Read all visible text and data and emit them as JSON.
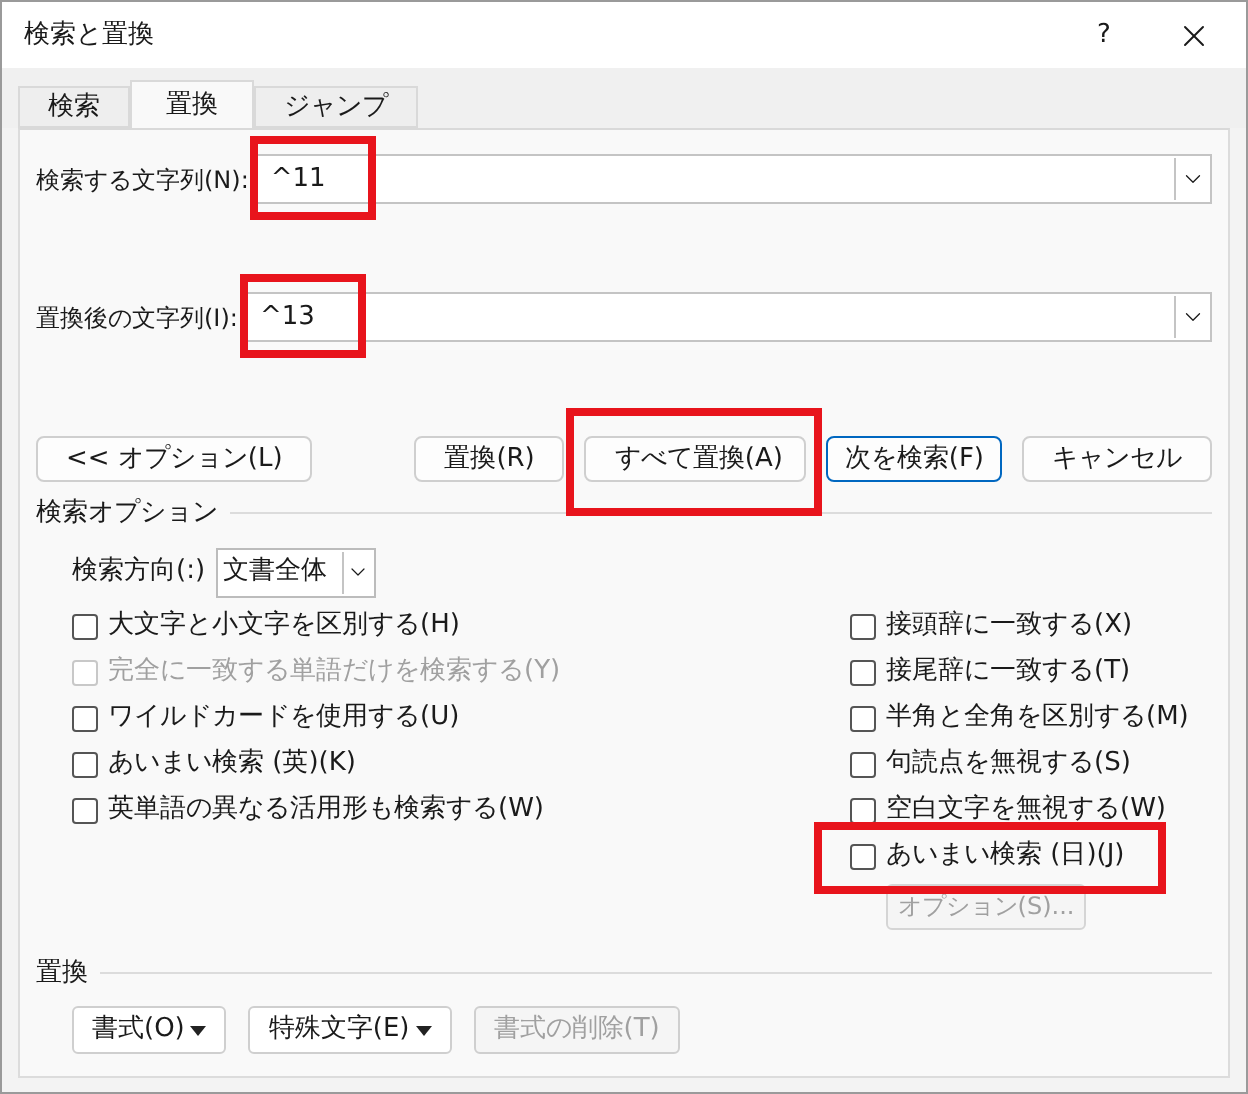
{
  "window": {
    "title": "検索と置換",
    "help": "?"
  },
  "tabs": [
    {
      "label": "検索",
      "selected": false
    },
    {
      "label": "置換",
      "selected": true
    },
    {
      "label": "ジャンプ",
      "selected": false
    }
  ],
  "fields": [
    {
      "label": "検索する文字列(N):",
      "value": "^11",
      "highlighted": true
    },
    {
      "label": "置換後の文字列(I):",
      "value": "^13",
      "highlighted": true
    }
  ],
  "buttons": [
    {
      "label": "<< オプション(L)",
      "default": false,
      "highlighted": false
    },
    {
      "label": "置換(R)",
      "default": false,
      "highlighted": false
    },
    {
      "label": "すべて置換(A)",
      "default": false,
      "highlighted": true
    },
    {
      "label": "次を検索(F)",
      "default": true,
      "highlighted": false
    },
    {
      "label": "キャンセル",
      "default": false,
      "highlighted": false
    }
  ],
  "search_options": {
    "title": "検索オプション",
    "direction_label": "検索方向(:)",
    "direction_value": "文書全体",
    "left": [
      {
        "label": "大文字と小文字を区別する(H)",
        "checked": false,
        "disabled": false,
        "highlighted": false
      },
      {
        "label": "完全に一致する単語だけを検索する(Y)",
        "checked": false,
        "disabled": true,
        "highlighted": false
      },
      {
        "label": "ワイルドカードを使用する(U)",
        "checked": false,
        "disabled": false,
        "highlighted": false
      },
      {
        "label": "あいまい検索 (英)(K)",
        "checked": false,
        "disabled": false,
        "highlighted": false
      },
      {
        "label": "英単語の異なる活用形も検索する(W)",
        "checked": false,
        "disabled": false,
        "highlighted": false
      }
    ],
    "right": [
      {
        "label": "接頭辞に一致する(X)",
        "checked": false,
        "disabled": false,
        "highlighted": false
      },
      {
        "label": "接尾辞に一致する(T)",
        "checked": false,
        "disabled": false,
        "highlighted": false
      },
      {
        "label": "半角と全角を区別する(M)",
        "checked": false,
        "disabled": false,
        "highlighted": false
      },
      {
        "label": "句読点を無視する(S)",
        "checked": false,
        "disabled": false,
        "highlighted": false
      },
      {
        "label": "空白文字を無視する(W)",
        "checked": false,
        "disabled": false,
        "highlighted": false
      },
      {
        "label": "あいまい検索 (日)(J)",
        "checked": false,
        "disabled": false,
        "highlighted": true
      }
    ],
    "options_button": {
      "label": "オプション(S)...",
      "disabled": true
    }
  },
  "replace": {
    "title": "置換",
    "buttons": [
      {
        "label": "書式(O)",
        "dropdown": true,
        "disabled": false
      },
      {
        "label": "特殊文字(E)",
        "dropdown": true,
        "disabled": false
      },
      {
        "label": "書式の削除(T)",
        "dropdown": false,
        "disabled": true
      }
    ]
  }
}
